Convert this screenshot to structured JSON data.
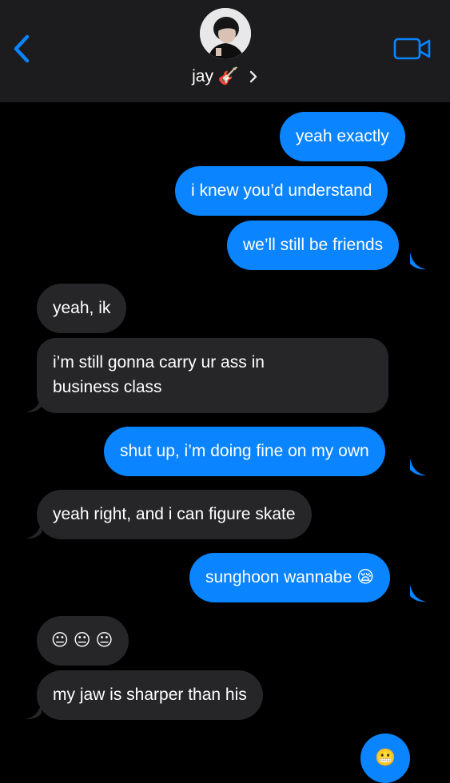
{
  "header": {
    "contact_name": "jay",
    "contact_emoji": "🎸"
  },
  "messages": [
    {
      "side": "sent",
      "text": "yeah exactly"
    },
    {
      "side": "sent",
      "text": "i knew you’d understand"
    },
    {
      "side": "sent",
      "text": "we’ll still be friends"
    },
    {
      "side": "received",
      "text": "yeah, ik"
    },
    {
      "side": "received",
      "line1": "i’m still gonna carry ur ass in",
      "line2": "business class"
    },
    {
      "side": "sent",
      "text": "shut up, i’m doing fine on my own"
    },
    {
      "side": "received",
      "text": "yeah right, and i can figure skate"
    },
    {
      "side": "sent",
      "text": "sunghoon wannabe",
      "emoji": "😪"
    },
    {
      "side": "received",
      "emojis": [
        "😐",
        "😐",
        "😐"
      ]
    },
    {
      "side": "received",
      "text": "my jaw is sharper than his"
    },
    {
      "side": "sent",
      "emojis": [
        "😬"
      ]
    }
  ],
  "colors": {
    "sent_bubble": "#0a84ff",
    "received_bubble": "#262628",
    "header_bg": "#1c1c1e",
    "background": "#000000"
  },
  "icons": [
    "back-chevron-icon",
    "video-call-icon",
    "chevron-right-icon"
  ]
}
